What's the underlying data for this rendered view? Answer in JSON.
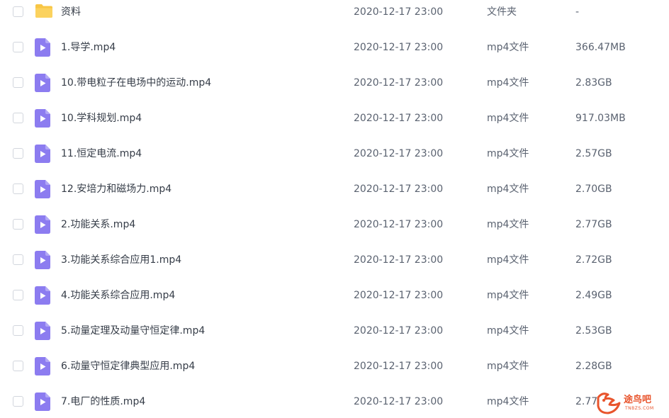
{
  "files": [
    {
      "name": "资料",
      "date": "2020-12-17 23:00",
      "type": "文件夹",
      "size": "-",
      "icon": "folder-icon"
    },
    {
      "name": "1.导学.mp4",
      "date": "2020-12-17 23:00",
      "type": "mp4文件",
      "size": "366.47MB",
      "icon": "video-file-icon"
    },
    {
      "name": "10.带电粒子在电场中的运动.mp4",
      "date": "2020-12-17 23:00",
      "type": "mp4文件",
      "size": "2.83GB",
      "icon": "video-file-icon"
    },
    {
      "name": "10.学科规划.mp4",
      "date": "2020-12-17 23:00",
      "type": "mp4文件",
      "size": "917.03MB",
      "icon": "video-file-icon"
    },
    {
      "name": "11.恒定电流.mp4",
      "date": "2020-12-17 23:00",
      "type": "mp4文件",
      "size": "2.57GB",
      "icon": "video-file-icon"
    },
    {
      "name": "12.安培力和磁场力.mp4",
      "date": "2020-12-17 23:00",
      "type": "mp4文件",
      "size": "2.70GB",
      "icon": "video-file-icon"
    },
    {
      "name": "2.功能关系.mp4",
      "date": "2020-12-17 23:00",
      "type": "mp4文件",
      "size": "2.77GB",
      "icon": "video-file-icon"
    },
    {
      "name": "3.功能关系综合应用1.mp4",
      "date": "2020-12-17 23:00",
      "type": "mp4文件",
      "size": "2.72GB",
      "icon": "video-file-icon"
    },
    {
      "name": "4.功能关系综合应用.mp4",
      "date": "2020-12-17 23:00",
      "type": "mp4文件",
      "size": "2.49GB",
      "icon": "video-file-icon"
    },
    {
      "name": "5.动量定理及动量守恒定律.mp4",
      "date": "2020-12-17 23:00",
      "type": "mp4文件",
      "size": "2.53GB",
      "icon": "video-file-icon"
    },
    {
      "name": "6.动量守恒定律典型应用.mp4",
      "date": "2020-12-17 23:00",
      "type": "mp4文件",
      "size": "2.28GB",
      "icon": "video-file-icon"
    },
    {
      "name": "7.电厂的性质.mp4",
      "date": "2020-12-17 23:00",
      "type": "mp4文件",
      "size": "2.77",
      "icon": "video-file-icon"
    }
  ],
  "colors": {
    "folder": "#f8c645",
    "video": "#8c7cf0",
    "watermark": "#e8542c"
  },
  "watermark": {
    "text": "途鸟吧",
    "sub": "TNBZS.COM"
  }
}
